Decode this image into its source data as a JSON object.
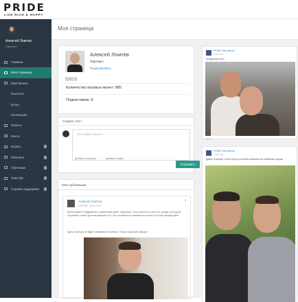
{
  "brand": {
    "name": "PRIDE",
    "tagline": "LIVE RICH & HAPPY"
  },
  "sidebar": {
    "user_name": "Алексей Ломтев",
    "user_role": "Партнер+",
    "items": [
      {
        "label": "Главная"
      },
      {
        "label": "Моя страница"
      },
      {
        "label": "Мой бизнес"
      },
      {
        "label": "Выплаты"
      },
      {
        "label": "Бонус"
      },
      {
        "label": "Мотивация"
      },
      {
        "label": "Пакеты"
      },
      {
        "label": "Лента"
      },
      {
        "label": "Играть"
      },
      {
        "label": "Рейтинги"
      },
      {
        "label": "Обучение"
      },
      {
        "label": "ToDo list"
      },
      {
        "label": "Служба поддержки"
      }
    ]
  },
  "page": {
    "title": "Моя страница"
  },
  "profile": {
    "name": "Алексей Ломтев",
    "role": "Партнер+",
    "edit_link": "Редактировать",
    "like_label": "Нравится",
    "coins_label": "Количество игровых монет: 985",
    "subscribers_label": "Подписчиков: 8"
  },
  "new_post": {
    "title": "Создать пост",
    "placeholder": "Что у Вас нового?",
    "attach_photo": "Добавить картинку",
    "attach_video": "Добавить видео",
    "submit_label": "Отправить"
  },
  "my_posts": {
    "title": "Мои публикации",
    "post": {
      "author": "Алексей Ломтев",
      "date": "8:59 PM · 19.02.2017",
      "close": "×",
      "text": "Всем привет! Поздравляю с субботним днём. Здоровья, чего хотелось у нас есть среда, в которой сохранять только долгоиграющие и то, что стремиться становиться лучше и лучше каждый день",
      "text2": "Здесь никогда не будет спамеров и нытиков. Только хорошие эмоции."
    }
  },
  "feed": [
    {
      "author": "PRIDE International",
      "date": "2 days ago",
      "caption": "Продюсеры все!",
      "likes": "Like · 4"
    },
    {
      "author": "PRIDE International",
      "date": "2 days ago",
      "caption": "Давно Ломтеву и Лёхе Оросу в новой компании на семейном отдыхе"
    }
  ]
}
